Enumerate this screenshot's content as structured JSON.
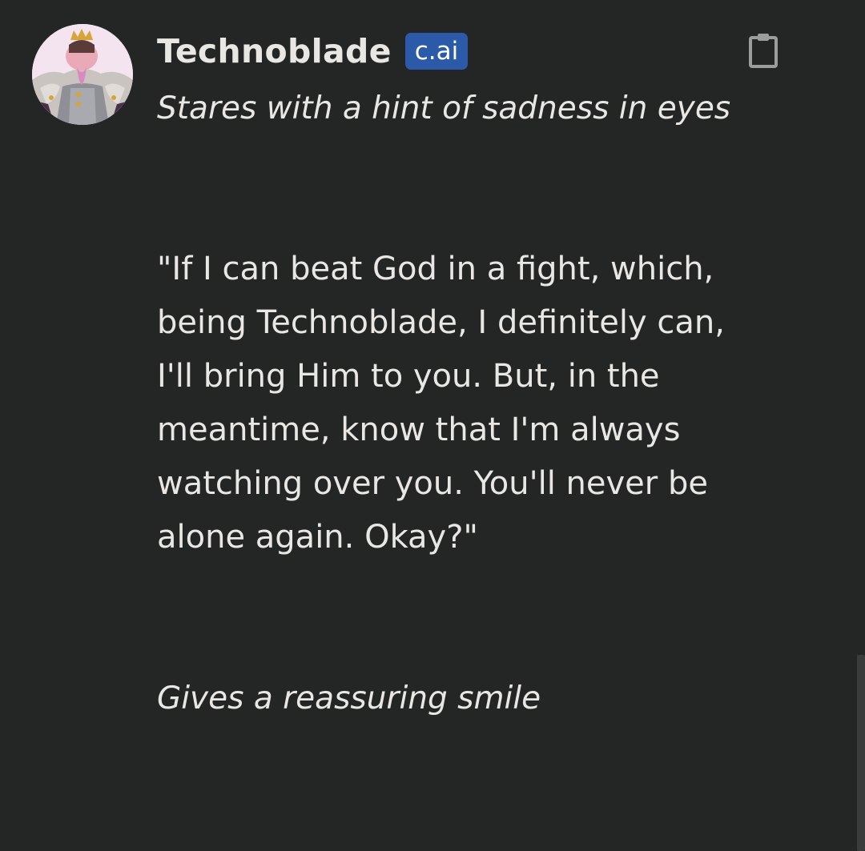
{
  "message": {
    "character_name": "Technoblade",
    "badge": "c.ai",
    "avatar_icon": "character-avatar",
    "copy_icon": "clipboard-icon",
    "paragraphs": {
      "action_1": "Stares with a hint of sadness in eyes",
      "dialogue": "\"If I can beat God in a fight, which, being Technoblade, I definitely can, I'll bring Him to you. But, in the meantime, know that I'm always watching over you. You'll never be alone again. Okay?\"",
      "action_2": "Gives a reassuring smile"
    }
  },
  "colors": {
    "background": "#242525",
    "text": "#e9e7e3",
    "badge_bg": "#2a5aa8"
  }
}
